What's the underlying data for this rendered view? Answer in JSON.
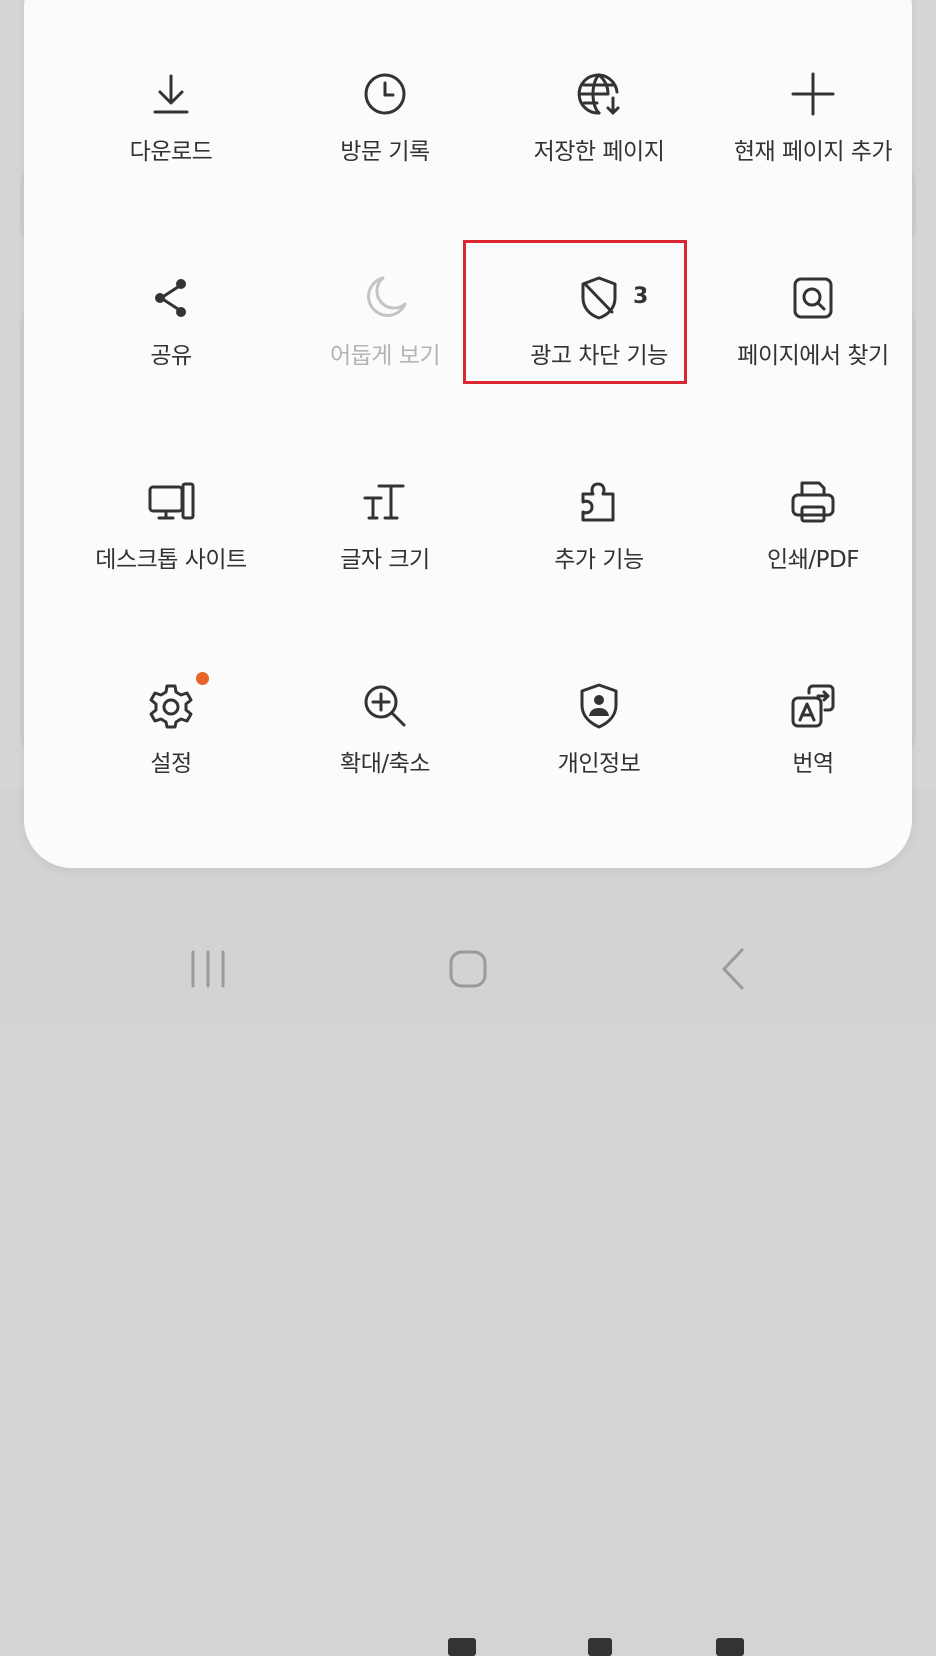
{
  "menu": {
    "items": [
      {
        "label": "다운로드",
        "icon": "download-icon"
      },
      {
        "label": "방문 기록",
        "icon": "clock-icon"
      },
      {
        "label": "저장한 페이지",
        "icon": "globe-download-icon"
      },
      {
        "label": "현재 페이지 추가",
        "icon": "plus-icon"
      },
      {
        "label": "공유",
        "icon": "share-icon"
      },
      {
        "label": "어둡게 보기",
        "icon": "moon-icon",
        "disabled": true
      },
      {
        "label": "광고 차단 기능",
        "icon": "shield-block-icon",
        "badge": "3",
        "highlighted": true
      },
      {
        "label": "페이지에서 찾기",
        "icon": "find-in-page-icon"
      },
      {
        "label": "데스크톱 사이트",
        "icon": "desktop-icon"
      },
      {
        "label": "글자 크기",
        "icon": "text-size-icon"
      },
      {
        "label": "추가 기능",
        "icon": "puzzle-icon"
      },
      {
        "label": "인쇄/PDF",
        "icon": "printer-icon"
      },
      {
        "label": "설정",
        "icon": "gear-icon",
        "notification": true
      },
      {
        "label": "확대/축소",
        "icon": "zoom-in-icon"
      },
      {
        "label": "개인정보",
        "icon": "privacy-shield-icon"
      },
      {
        "label": "번역",
        "icon": "translate-icon"
      }
    ]
  },
  "navbar": {
    "buttons": [
      "recent-apps-icon",
      "home-icon",
      "back-icon"
    ]
  },
  "colors": {
    "panel_bg": "#fbfbfb",
    "text": "#333333",
    "disabled_text": "#b4b4b4",
    "highlight_border": "#d9282f",
    "notification_dot": "#e8632a"
  }
}
